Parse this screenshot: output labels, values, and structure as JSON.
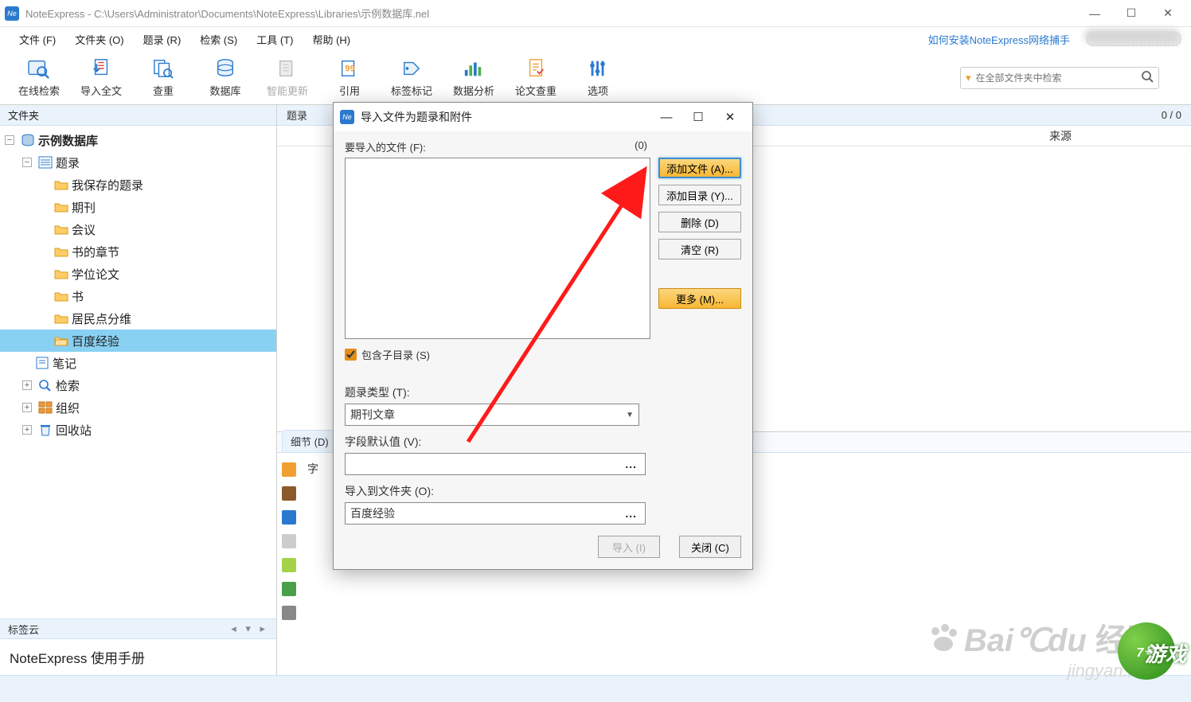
{
  "window": {
    "title": "NoteExpress - C:\\Users\\Administrator\\Documents\\NoteExpress\\Libraries\\示例数据库.nel"
  },
  "menubar": {
    "items": [
      "文件 (F)",
      "文件夹 (O)",
      "题录 (R)",
      "检索 (S)",
      "工具 (T)",
      "帮助 (H)"
    ],
    "help_link": "如何安装NoteExpress网络捕手"
  },
  "toolbar": {
    "items": [
      {
        "label": "在线检索",
        "enabled": true
      },
      {
        "label": "导入全文",
        "enabled": true
      },
      {
        "label": "查重",
        "enabled": true
      },
      {
        "label": "数据库",
        "enabled": true
      },
      {
        "label": "智能更新",
        "enabled": false
      },
      {
        "label": "引用",
        "enabled": true
      },
      {
        "label": "标签标记",
        "enabled": true
      },
      {
        "label": "数据分析",
        "enabled": true
      },
      {
        "label": "论文查重",
        "enabled": true
      },
      {
        "label": "选项",
        "enabled": true
      }
    ],
    "search_placeholder": "在全部文件夹中检索"
  },
  "sidebar": {
    "header": "文件夹",
    "root": "示例数据库",
    "tree": {
      "tilu": "题录",
      "children": [
        "我保存的题录",
        "期刊",
        "会议",
        "书的章节",
        "学位论文",
        "书",
        "居民点分维",
        "百度经验"
      ],
      "others": [
        "笔记",
        "检索",
        "组织",
        "回收站"
      ]
    },
    "tagcloud_header": "标签云",
    "tagcloud_body": "NoteExpress  使用手册"
  },
  "content": {
    "list_header": "题录",
    "count": "0 / 0",
    "col_source": "来源",
    "detail_tab": "细节 (D)",
    "detail_field_label": "字"
  },
  "dialog": {
    "title": "导入文件为题录和附件",
    "files_label": "要导入的文件 (F):",
    "files_count": "(0)",
    "btn_add_file": "添加文件 (A)...",
    "btn_add_dir": "添加目录 (Y)...",
    "btn_delete": "删除 (D)",
    "btn_clear": "清空 (R)",
    "btn_more": "更多 (M)...",
    "chk_subdir": "包含子目录 (S)",
    "type_label": "题录类型 (T):",
    "type_value": "期刊文章",
    "default_label": "字段默认值 (V):",
    "folder_label": "导入到文件夹 (O):",
    "folder_value": "百度经验",
    "btn_import": "导入 (I)",
    "btn_close": "关闭 (C)"
  },
  "watermark": {
    "big_cn1": "Bai",
    "big_cn2": "du",
    "big_cn3": "经验",
    "url": "jingyan.bai",
    "logo_num": "7号",
    "logo_txt": "游戏"
  }
}
